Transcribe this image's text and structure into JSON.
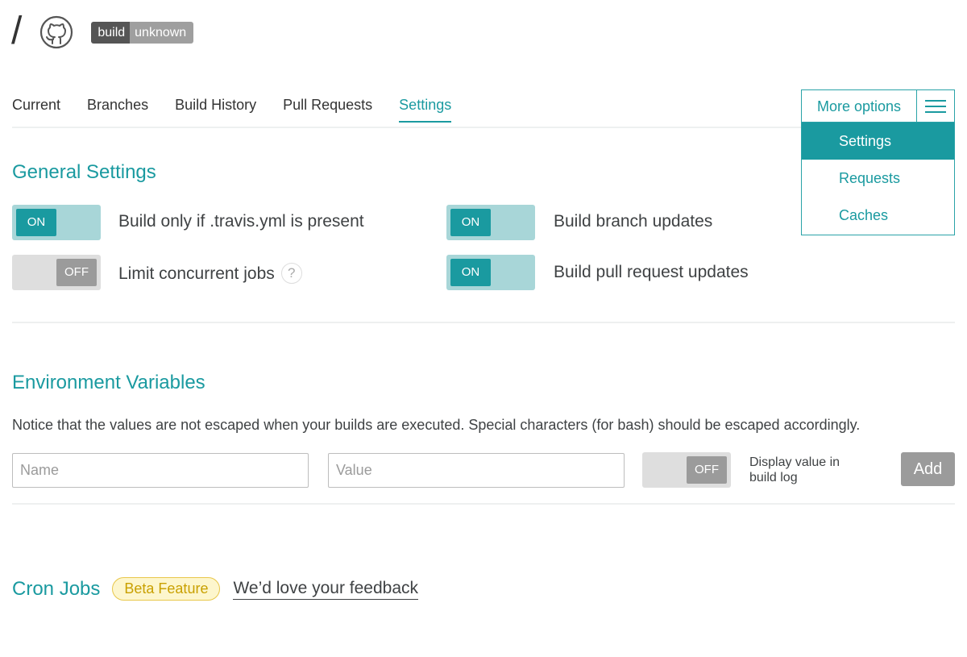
{
  "header": {
    "slash": "/",
    "badge": {
      "left": "build",
      "right": "unknown"
    }
  },
  "tabs": [
    {
      "label": "Current"
    },
    {
      "label": "Branches"
    },
    {
      "label": "Build History"
    },
    {
      "label": "Pull Requests"
    },
    {
      "label": "Settings",
      "active": true
    }
  ],
  "more_options": {
    "label": "More options",
    "items": [
      {
        "label": "Settings",
        "active": true
      },
      {
        "label": "Requests"
      },
      {
        "label": "Caches"
      }
    ]
  },
  "general": {
    "title": "General Settings",
    "settings": [
      {
        "label": "Build only if .travis.yml is present",
        "state": "ON"
      },
      {
        "label": "Build branch updates",
        "state": "ON"
      },
      {
        "label": "Limit concurrent jobs",
        "state": "OFF",
        "help": "?"
      },
      {
        "label": "Build pull request updates",
        "state": "ON"
      }
    ]
  },
  "env": {
    "title": "Environment Variables",
    "notice": "Notice that the values are not escaped when your builds are executed. Special characters (for bash) should be escaped accordingly.",
    "name_placeholder": "Name",
    "value_placeholder": "Value",
    "display_toggle": "OFF",
    "display_label": "Display value in build log",
    "add_label": "Add"
  },
  "cron": {
    "title": "Cron Jobs",
    "beta": "Beta Feature",
    "feedback": "We’d love your feedback"
  },
  "colors": {
    "accent": "#1a9aa0",
    "toggle_on_bg": "#a8d6d8",
    "toggle_off_bg": "#dedede",
    "beta_border": "#e8c74b"
  }
}
